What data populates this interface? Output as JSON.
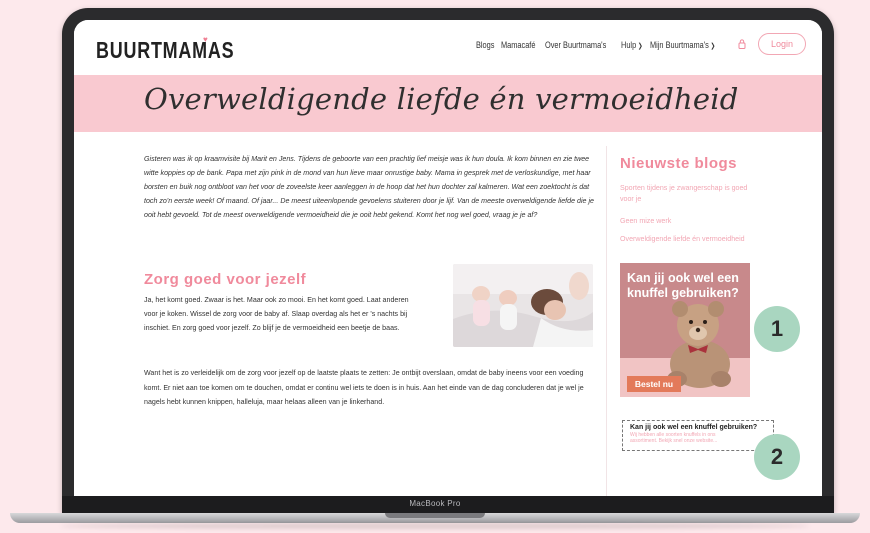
{
  "device": {
    "label": "MacBook Pro"
  },
  "header": {
    "logo": "BUURTMAMAS",
    "nav": [
      {
        "label": "Blogs",
        "dropdown": false
      },
      {
        "label": "Mamacafé",
        "dropdown": false
      },
      {
        "label": "Over Buurtmama's",
        "dropdown": false
      },
      {
        "label": "Hulp",
        "dropdown": true
      },
      {
        "label": "Mijn Buurtmama's",
        "dropdown": true
      }
    ],
    "login_label": "Login"
  },
  "hero": {
    "title": "Overweldigende liefde én vermoeidheid"
  },
  "article": {
    "intro": "Gisteren was ik op kraamvisite bij Marit en Jens. Tijdens de geboorte van een prachtig lief meisje was ik hun doula. Ik kom binnen en zie twee witte koppies op de bank. Papa met zijn pink in de mond van hun lieve maar onrustige baby. Mama in gesprek met de verloskundige, met haar borsten en buik nog ontbloot van het voor de zoveelste keer aanleggen in de hoop dat het hun dochter zal kalmeren. Wat een zoektocht is dat toch zo'n eerste week! Of maand. Of jaar... De meest uiteenlopende gevoelens stuiteren door je lijf. Van de meeste overweldigende liefde die je ooit hebt gevoeld. Tot de meest overweldigende vermoeidheid die je ooit hebt gekend. Komt het nog wel goed, vraag je je af?",
    "section_title": "Zorg goed voor jezelf",
    "section_text": "Ja, het komt goed. Zwaar is het. Maar ook zo mooi. En het komt goed. Laat anderen voor je koken. Wissel de zorg voor de baby af. Slaap overdag als het er 's nachts bij inschiet. En zorg goed voor jezelf. Zo blijf je de vermoeidheid een beetje de baas.",
    "paragraph": "Want het is zo verleidelijk om de zorg voor jezelf op de laatste plaats te zetten: Je ontbijt overslaan, omdat de baby ineens voor een voeding komt. Er niet aan toe komen om te douchen, omdat er continu wel iets te doen is in huis. Aan het einde van de dag concluderen dat je wel je nagels hebt kunnen knippen, halleluja, maar helaas alleen van je linkerhand."
  },
  "sidebar": {
    "title": "Nieuwste blogs",
    "links": [
      "Sporten tijdens je zwangerschap is goed voor je",
      "Geen mize werk",
      "Overweldigende liefde én vermoeidheid"
    ],
    "ad": {
      "title": "Kan jij ook wel een knuffel gebruiken?",
      "button": "Bestel nu"
    },
    "text_ad": {
      "title": "Kan jij ook wel een knuffel gebruiken?",
      "body": "Wij hebben alle soorten knuffels in ons assortiment. Bekijk snel onze website..."
    }
  },
  "badges": [
    "1",
    "2"
  ],
  "colors": {
    "pink": "#f08a9c",
    "hero_bg": "#f9c9d0",
    "badge": "#a9d6c0",
    "background": "#fde9ec"
  }
}
